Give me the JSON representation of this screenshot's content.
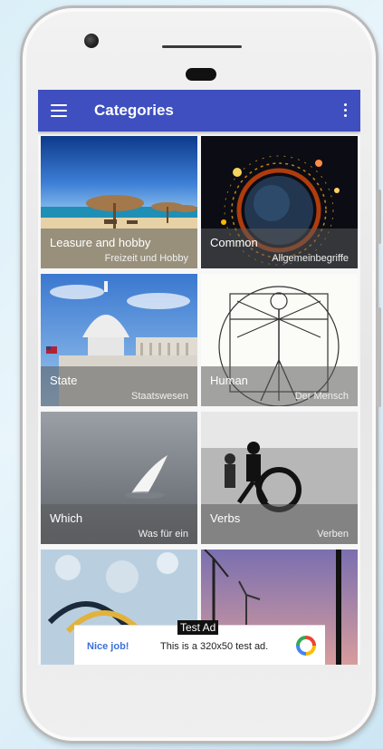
{
  "app": {
    "title": "Categories"
  },
  "categories": [
    {
      "en": "Leasure and hobby",
      "de": "Freizeit und Hobby"
    },
    {
      "en": "Common",
      "de": "Allgemeinbegriffe"
    },
    {
      "en": "State",
      "de": "Staatswesen"
    },
    {
      "en": "Human",
      "de": "Der Mensch"
    },
    {
      "en": "Which",
      "de": "Was für ein"
    },
    {
      "en": "Verbs",
      "de": "Verben"
    },
    {
      "en": "",
      "de": ""
    },
    {
      "en": "",
      "de": ""
    }
  ],
  "ad": {
    "badge": "Test Ad",
    "left_text": "Nice job!",
    "message": "This is a 320x50 test ad."
  },
  "colors": {
    "appbar": "#3f4fbf",
    "accent_link": "#3b6fd8"
  },
  "icons": {
    "menu": "hamburger-menu-icon",
    "overflow": "more-vert-icon",
    "ad_logo": "ad-network-logo-icon"
  }
}
